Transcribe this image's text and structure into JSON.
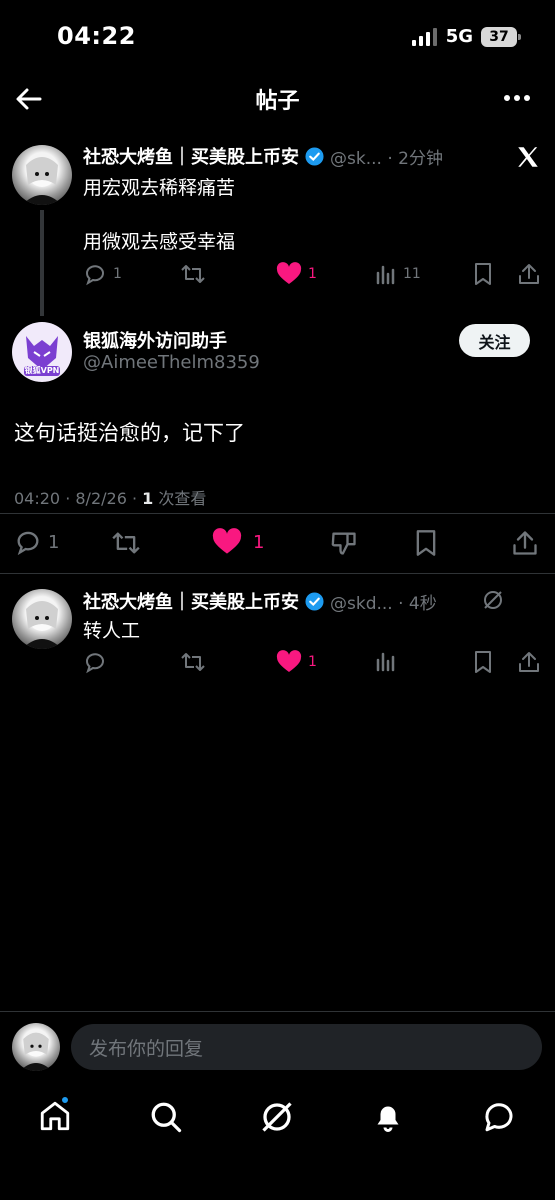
{
  "status_bar": {
    "time": "04:22",
    "network": "5G",
    "battery": "37"
  },
  "header": {
    "title": "帖子"
  },
  "colors": {
    "accent_pink": "#f91880",
    "verified_blue": "#1d9bf0",
    "background": "#000000"
  },
  "parent_post": {
    "display_name": "社恐大烤鱼｜买美股上币安",
    "handle_time": "@sk... · 2分钟",
    "line1": "用宏观去稀释痛苦",
    "line2": "用微观去感受幸福",
    "replies": "1",
    "likes": "1",
    "views": "11"
  },
  "main_post": {
    "display_name": "银狐海外访问助手",
    "handle": "@AimeeThelm8359",
    "follow_label": "关注",
    "avatar_label": "银狐VPN",
    "text": "这句话挺治愈的，记下了",
    "meta_time": "04:20 · 8/2/26 · ",
    "meta_views": "1",
    "meta_views_label": " 次查看",
    "replies": "1",
    "likes": "1"
  },
  "reply_post": {
    "display_name": "社恐大烤鱼｜买美股上币安",
    "handle_time": "@skd... · 4秒",
    "text": "转人工",
    "likes": "1"
  },
  "compose": {
    "placeholder": "发布你的回复"
  },
  "bottom_nav": [
    "home-icon",
    "search-icon",
    "grok-icon",
    "notifications-icon",
    "messages-icon"
  ]
}
